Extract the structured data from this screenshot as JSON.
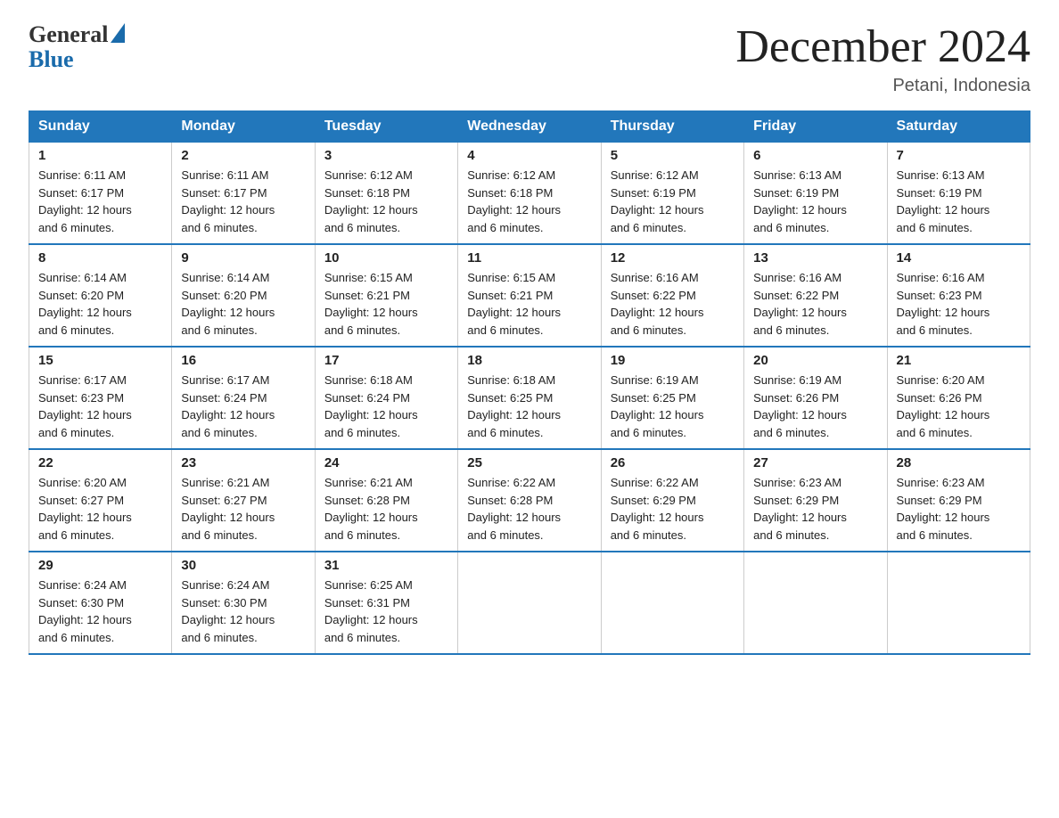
{
  "logo": {
    "general": "General",
    "blue": "Blue"
  },
  "title": "December 2024",
  "location": "Petani, Indonesia",
  "header": {
    "days": [
      "Sunday",
      "Monday",
      "Tuesday",
      "Wednesday",
      "Thursday",
      "Friday",
      "Saturday"
    ]
  },
  "weeks": [
    [
      {
        "day": "1",
        "sunrise": "6:11 AM",
        "sunset": "6:17 PM",
        "daylight": "12 hours and 6 minutes."
      },
      {
        "day": "2",
        "sunrise": "6:11 AM",
        "sunset": "6:17 PM",
        "daylight": "12 hours and 6 minutes."
      },
      {
        "day": "3",
        "sunrise": "6:12 AM",
        "sunset": "6:18 PM",
        "daylight": "12 hours and 6 minutes."
      },
      {
        "day": "4",
        "sunrise": "6:12 AM",
        "sunset": "6:18 PM",
        "daylight": "12 hours and 6 minutes."
      },
      {
        "day": "5",
        "sunrise": "6:12 AM",
        "sunset": "6:19 PM",
        "daylight": "12 hours and 6 minutes."
      },
      {
        "day": "6",
        "sunrise": "6:13 AM",
        "sunset": "6:19 PM",
        "daylight": "12 hours and 6 minutes."
      },
      {
        "day": "7",
        "sunrise": "6:13 AM",
        "sunset": "6:19 PM",
        "daylight": "12 hours and 6 minutes."
      }
    ],
    [
      {
        "day": "8",
        "sunrise": "6:14 AM",
        "sunset": "6:20 PM",
        "daylight": "12 hours and 6 minutes."
      },
      {
        "day": "9",
        "sunrise": "6:14 AM",
        "sunset": "6:20 PM",
        "daylight": "12 hours and 6 minutes."
      },
      {
        "day": "10",
        "sunrise": "6:15 AM",
        "sunset": "6:21 PM",
        "daylight": "12 hours and 6 minutes."
      },
      {
        "day": "11",
        "sunrise": "6:15 AM",
        "sunset": "6:21 PM",
        "daylight": "12 hours and 6 minutes."
      },
      {
        "day": "12",
        "sunrise": "6:16 AM",
        "sunset": "6:22 PM",
        "daylight": "12 hours and 6 minutes."
      },
      {
        "day": "13",
        "sunrise": "6:16 AM",
        "sunset": "6:22 PM",
        "daylight": "12 hours and 6 minutes."
      },
      {
        "day": "14",
        "sunrise": "6:16 AM",
        "sunset": "6:23 PM",
        "daylight": "12 hours and 6 minutes."
      }
    ],
    [
      {
        "day": "15",
        "sunrise": "6:17 AM",
        "sunset": "6:23 PM",
        "daylight": "12 hours and 6 minutes."
      },
      {
        "day": "16",
        "sunrise": "6:17 AM",
        "sunset": "6:24 PM",
        "daylight": "12 hours and 6 minutes."
      },
      {
        "day": "17",
        "sunrise": "6:18 AM",
        "sunset": "6:24 PM",
        "daylight": "12 hours and 6 minutes."
      },
      {
        "day": "18",
        "sunrise": "6:18 AM",
        "sunset": "6:25 PM",
        "daylight": "12 hours and 6 minutes."
      },
      {
        "day": "19",
        "sunrise": "6:19 AM",
        "sunset": "6:25 PM",
        "daylight": "12 hours and 6 minutes."
      },
      {
        "day": "20",
        "sunrise": "6:19 AM",
        "sunset": "6:26 PM",
        "daylight": "12 hours and 6 minutes."
      },
      {
        "day": "21",
        "sunrise": "6:20 AM",
        "sunset": "6:26 PM",
        "daylight": "12 hours and 6 minutes."
      }
    ],
    [
      {
        "day": "22",
        "sunrise": "6:20 AM",
        "sunset": "6:27 PM",
        "daylight": "12 hours and 6 minutes."
      },
      {
        "day": "23",
        "sunrise": "6:21 AM",
        "sunset": "6:27 PM",
        "daylight": "12 hours and 6 minutes."
      },
      {
        "day": "24",
        "sunrise": "6:21 AM",
        "sunset": "6:28 PM",
        "daylight": "12 hours and 6 minutes."
      },
      {
        "day": "25",
        "sunrise": "6:22 AM",
        "sunset": "6:28 PM",
        "daylight": "12 hours and 6 minutes."
      },
      {
        "day": "26",
        "sunrise": "6:22 AM",
        "sunset": "6:29 PM",
        "daylight": "12 hours and 6 minutes."
      },
      {
        "day": "27",
        "sunrise": "6:23 AM",
        "sunset": "6:29 PM",
        "daylight": "12 hours and 6 minutes."
      },
      {
        "day": "28",
        "sunrise": "6:23 AM",
        "sunset": "6:29 PM",
        "daylight": "12 hours and 6 minutes."
      }
    ],
    [
      {
        "day": "29",
        "sunrise": "6:24 AM",
        "sunset": "6:30 PM",
        "daylight": "12 hours and 6 minutes."
      },
      {
        "day": "30",
        "sunrise": "6:24 AM",
        "sunset": "6:30 PM",
        "daylight": "12 hours and 6 minutes."
      },
      {
        "day": "31",
        "sunrise": "6:25 AM",
        "sunset": "6:31 PM",
        "daylight": "12 hours and 6 minutes."
      },
      null,
      null,
      null,
      null
    ]
  ],
  "labels": {
    "sunrise": "Sunrise:",
    "sunset": "Sunset:",
    "daylight": "Daylight:"
  }
}
